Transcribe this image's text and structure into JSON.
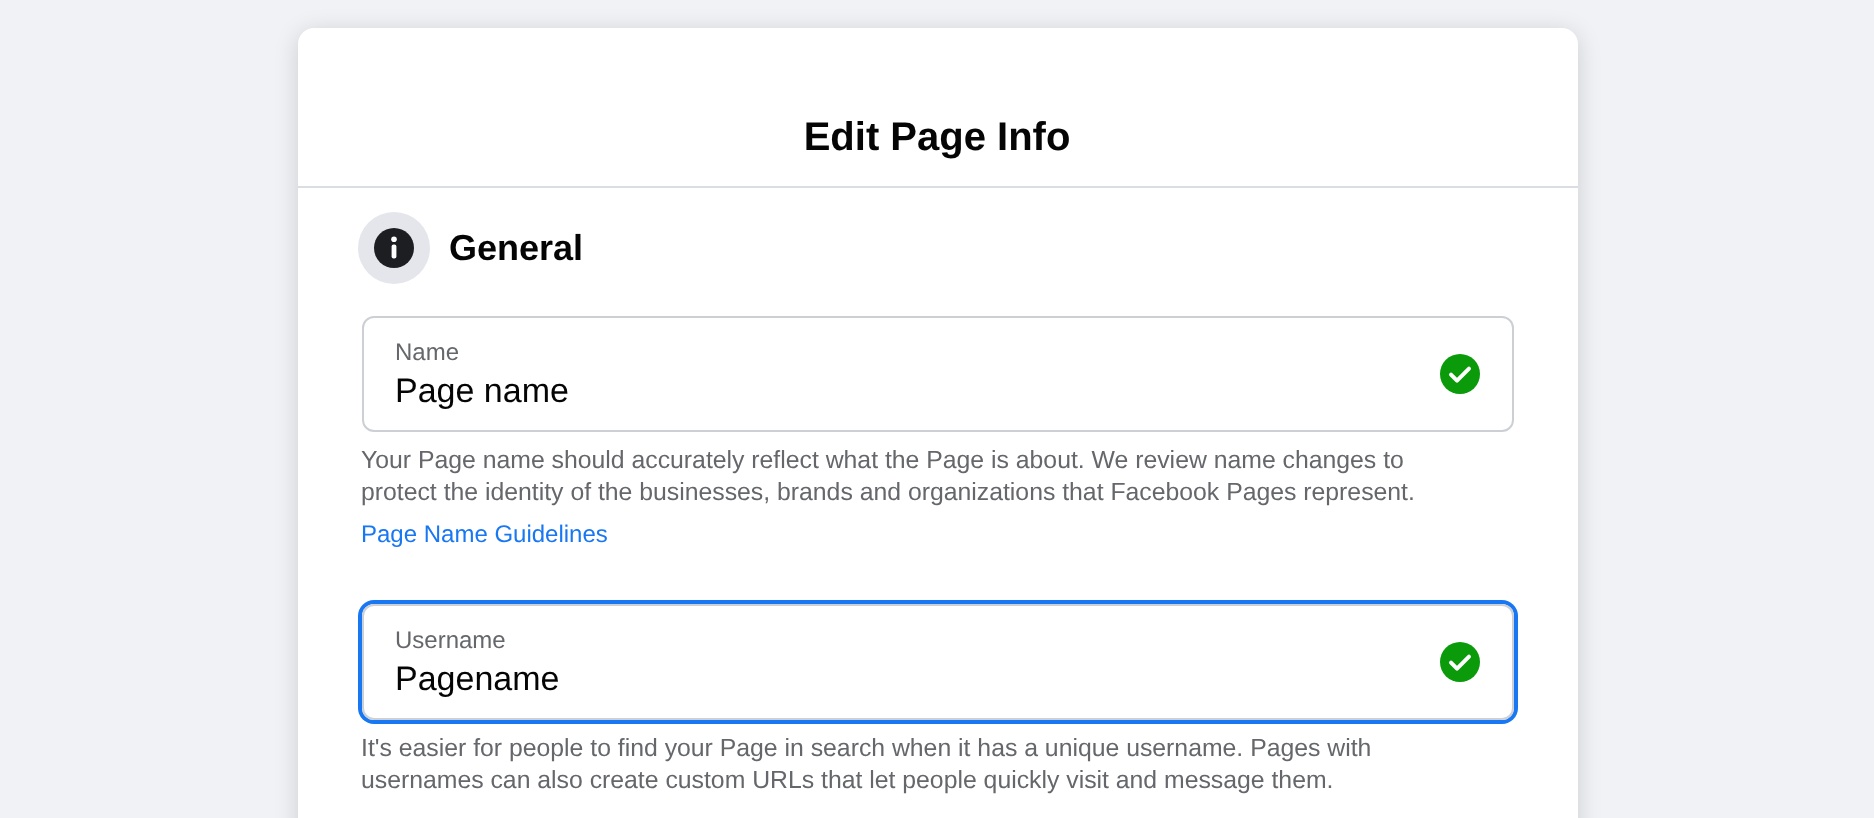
{
  "dialog": {
    "title": "Edit Page Info"
  },
  "section": {
    "title": "General"
  },
  "fields": [
    {
      "label": "Name",
      "value": "Page name",
      "valid": true,
      "focused": false,
      "help": "Your Page name should accurately reflect what the Page is about. We review name changes to protect the identity of the businesses, brands and organizations that Facebook Pages represent.",
      "link": "Page Name Guidelines"
    },
    {
      "label": "Username",
      "value": "Pagename",
      "valid": true,
      "focused": true,
      "help": "It's easier for people to find your Page in search when it has a unique username. Pages with usernames can also create custom URLs that let people quickly visit and message them."
    }
  ]
}
